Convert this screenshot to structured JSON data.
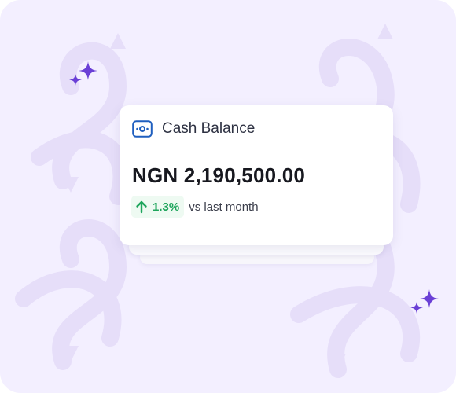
{
  "card": {
    "title": "Cash Balance",
    "amount": "NGN 2,190,500.00",
    "change": {
      "value": "1.3%",
      "direction": "up",
      "suffix": "vs last month"
    }
  },
  "icons": {
    "card_icon": "wallet-icon",
    "change_icon": "arrow-up-icon",
    "decoration": "sparkle-icon"
  },
  "colors": {
    "background": "#f3efff",
    "accent_purple": "#6a3fd6",
    "icon_blue": "#1f5fbf",
    "positive_green": "#1ea55c",
    "positive_bg": "#eefaf2",
    "text_dark": "#17181f"
  }
}
